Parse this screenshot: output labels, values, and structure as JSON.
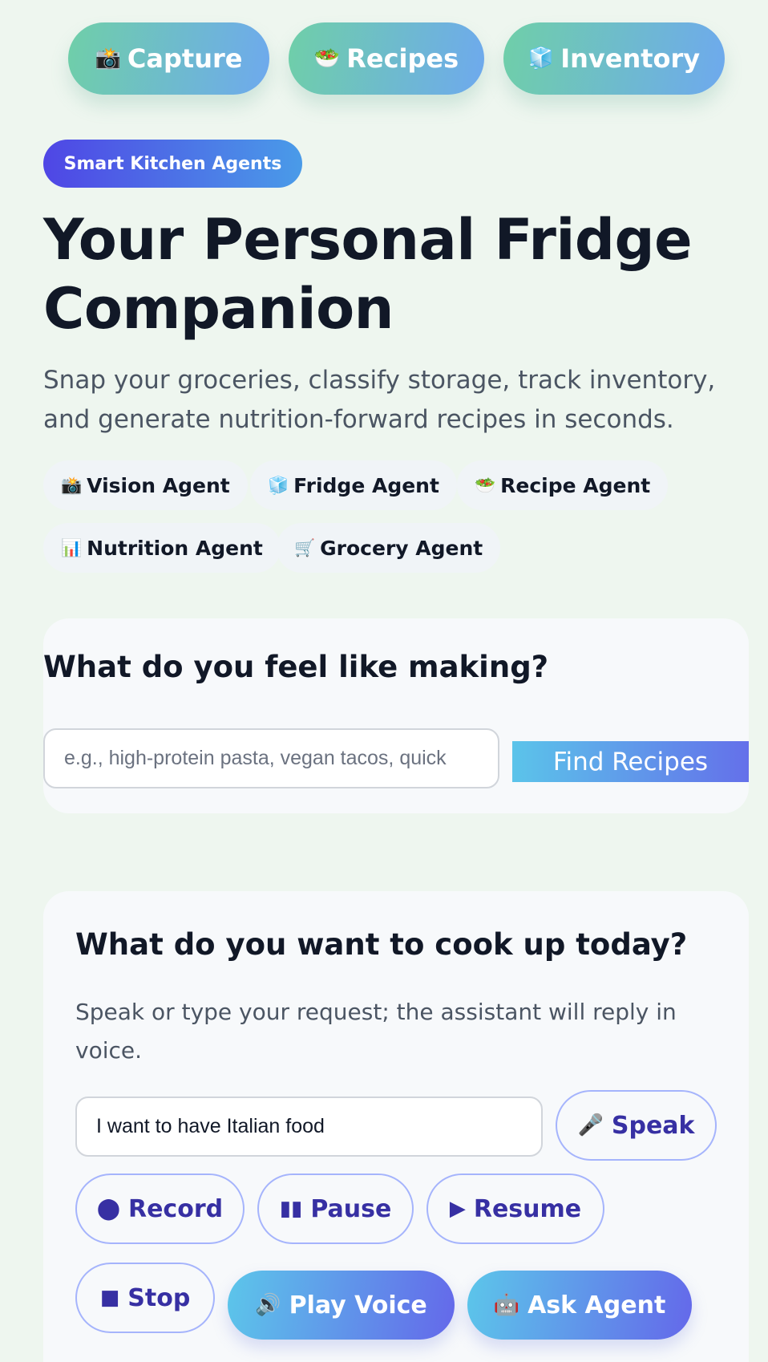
{
  "nav": {
    "capture": {
      "icon": "📸",
      "icon_name": "camera-icon",
      "label": "Capture"
    },
    "recipes": {
      "icon": "🥗",
      "icon_name": "salad-icon",
      "label": "Recipes"
    },
    "inventory": {
      "icon": "🧊",
      "icon_name": "ice-cube-icon",
      "label": "Inventory"
    }
  },
  "hero": {
    "tag": "Smart Kitchen Agents",
    "title": "Your Personal Fridge Companion",
    "subtitle": "Snap your groceries, classify storage, track inventory, and generate nutrition-forward recipes in seconds."
  },
  "agents": [
    {
      "icon": "📸",
      "icon_name": "camera-icon",
      "label": "Vision Agent"
    },
    {
      "icon": "🧊",
      "icon_name": "ice-cube-icon",
      "label": "Fridge Agent"
    },
    {
      "icon": "🥗",
      "icon_name": "salad-icon",
      "label": "Recipe Agent"
    },
    {
      "icon": "📊",
      "icon_name": "bar-chart-icon",
      "label": "Nutrition Agent"
    },
    {
      "icon": "🛒",
      "icon_name": "shopping-cart-icon",
      "label": "Grocery Agent"
    }
  ],
  "recipe_search": {
    "title": "What do you feel like making?",
    "placeholder": "e.g., high-protein pasta, vegan tacos, quick",
    "button_label": "Find Recipes"
  },
  "voice": {
    "title": "What do you want to cook up today?",
    "subtitle": "Speak or type your request; the assistant will reply in voice.",
    "input_value": "I want to have Italian food",
    "speak": {
      "icon": "🎤",
      "label": "Speak"
    },
    "record": {
      "icon": "⬤",
      "label": "Record"
    },
    "pause": {
      "icon": "▮▮",
      "label": "Pause"
    },
    "resume": {
      "icon": "▶",
      "label": "Resume"
    },
    "stop": {
      "icon": "■",
      "label": "Stop"
    },
    "play": {
      "icon": "🔊",
      "label": "Play Voice"
    },
    "ask": {
      "icon": "🤖",
      "label": "Ask Agent"
    }
  },
  "colors": {
    "background": "#eef6ef",
    "nav_gradient_start": "#6fcfa8",
    "nav_gradient_end": "#6ea9ee",
    "accent_indigo": "#4f46e5",
    "button_text": "#3730a3"
  }
}
